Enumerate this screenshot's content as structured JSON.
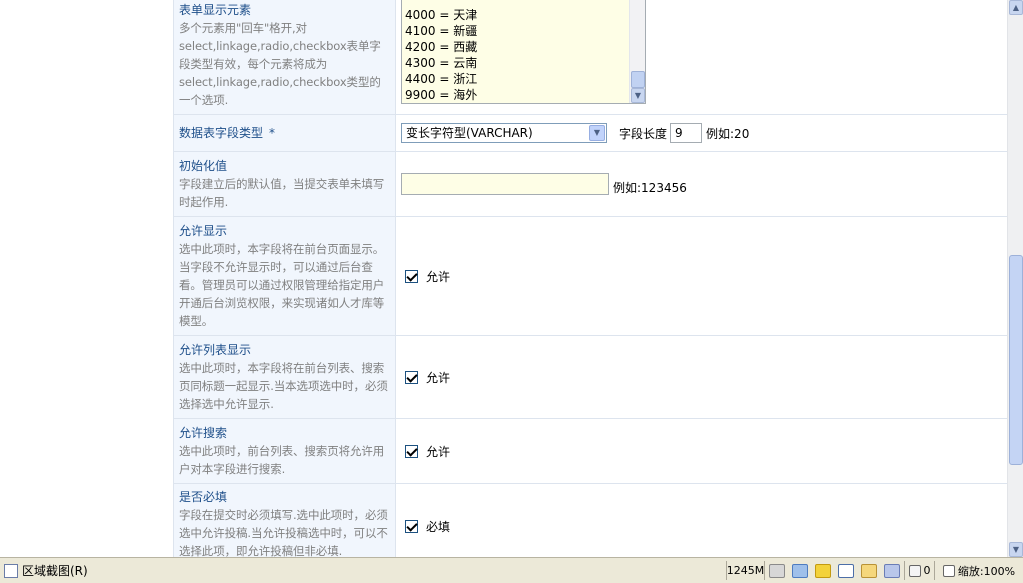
{
  "rows": {
    "options": {
      "title": "表单显示元素",
      "desc": "多个元素用\"回车\"格开,对select,linkage,radio,checkbox表单字段类型有效，每个元素将成为select,linkage,radio,checkbox类型的一个选项.",
      "list_items": [
        "4000 = 天津",
        "4100 = 新疆",
        "4200 = 西藏",
        "4300 = 云南",
        "4400 = 浙江",
        "9900 = 海外"
      ]
    },
    "field_type": {
      "title": "数据表字段类型",
      "required_mark": "*",
      "select_value": "变长字符型(VARCHAR)",
      "length_label": "字段长度",
      "length_value": "9",
      "example": "例如:20"
    },
    "default_value": {
      "title": "初始化值",
      "desc": "字段建立后的默认值，当提交表单未填写时起作用.",
      "input_value": "",
      "example": "例如:123456"
    },
    "allow_display": {
      "title": "允许显示",
      "desc": "选中此项时，本字段将在前台页面显示。当字段不允许显示时，可以通过后台查看。管理员可以通过权限管理给指定用户开通后台浏览权限，来实现诸如人才库等模型。",
      "checkbox_label": "允许",
      "checked": true
    },
    "allow_list": {
      "title": "允许列表显示",
      "desc": "选中此项时，本字段将在前台列表、搜索页同标题一起显示.当本选项选中时，必须选择选中允许显示.",
      "checkbox_label": "允许",
      "checked": true
    },
    "allow_search": {
      "title": "允许搜索",
      "desc": "选中此项时，前台列表、搜索页将允许用户对本字段进行搜索.",
      "checkbox_label": "允许",
      "checked": true
    },
    "required": {
      "title": "是否必填",
      "desc": "字段在提交时必须填写.选中此项时，必须选中允许投稿.当允许投稿选中时，可以不选择此项，即允许投稿但非必填.",
      "checkbox_label": "必填",
      "checked": true
    }
  },
  "statusbar": {
    "left_text": "区域截图(R)",
    "memory": "1245M",
    "counter": "0",
    "zoom": "缩放:100%"
  },
  "colors": {
    "label_bg": "#f1f6fd",
    "title_text": "#1e4f8a",
    "desc_text": "#808080",
    "input_bg": "#fefee6"
  }
}
